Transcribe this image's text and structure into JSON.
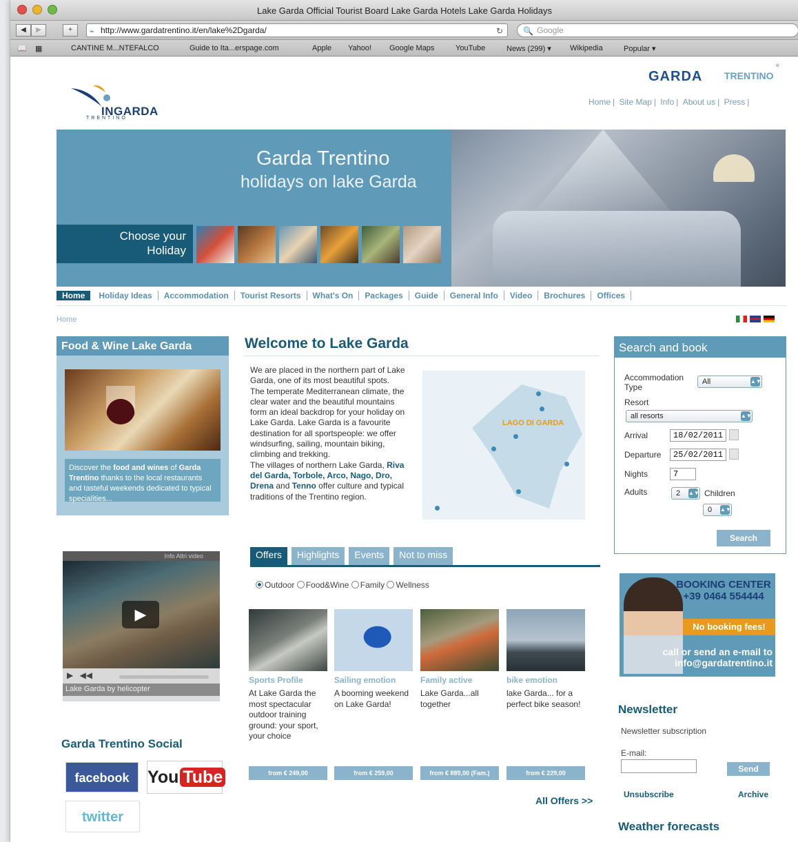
{
  "browser": {
    "title": "Lake Garda Official Tourist Board Lake Garda Hotels Lake Garda Holidays",
    "url": "http://www.gardatrentino.it/en/lake%2Dgarda/",
    "search_placeholder": "Google",
    "bookmarks": [
      "CANTINE M...NTEFALCO",
      "Guide to Ita...erspage.com",
      "Apple",
      "Yahoo!",
      "Google Maps",
      "YouTube",
      "News (299) ▾",
      "Wikipedia",
      "Popular ▾"
    ]
  },
  "header": {
    "logo_text": "INGARDA",
    "logo_sub": "TRENTINO",
    "brand_garda": "GARDA",
    "brand_trentino": "TRENTINO",
    "top_links": [
      "Home",
      "Site Map",
      "Info",
      "About us",
      "Press"
    ]
  },
  "hero": {
    "title": "Garda Trentino",
    "subtitle": "holidays on lake Garda",
    "choose_line1": "Choose your",
    "choose_line2": "Holiday"
  },
  "nav": {
    "items": [
      "Home",
      "Holiday Ideas",
      "Accommodation",
      "Tourist Resorts",
      "What's On",
      "Packages",
      "Guide",
      "General Info",
      "Video",
      "Brochures",
      "Offices"
    ]
  },
  "breadcrumb": "Home",
  "food_wine": {
    "title": "Food & Wine Lake Garda",
    "text_pre": "Discover the ",
    "text_bold": "food and wines",
    "text_mid": " of ",
    "text_bold2": "Garda Trentino",
    "text_post": " thanks to the local restaurants and tasteful weekends dedicated to typical specialities..."
  },
  "video": {
    "controls_label": "Info  Altri video",
    "caption": "Lake Garda by helicopter"
  },
  "social": {
    "title": "Garda Trentino Social",
    "facebook": "facebook",
    "youtube_you": "You",
    "youtube_tube": "Tube",
    "twitter": "twitter"
  },
  "welcome": {
    "title": "Welcome to Lake Garda",
    "p1": "We are placed in the northern part of Lake Garda, one of its most beautiful spots.",
    "p2": "The temperate Mediterranean climate, the clear water and the beautiful mountains form an ideal backdrop for your holiday on Lake Garda. Lake Garda is a favourite destination for all sportspeople: we offer windsurfing, sailing, mountain biking, climbing and trekking.",
    "p3_pre": "The villages of northern Lake Garda, ",
    "p3_towns": "Riva del Garda, Torbole, Arco, Nago, Dro, Drena",
    "p3_and": " and ",
    "p3_tenno": "Tenno",
    "p3_post": " offer culture and typical traditions of the Trentino region.",
    "map_label": "LAGO DI GARDA"
  },
  "offers": {
    "tabs": [
      "Offers",
      "Highlights",
      "Events",
      "Not to miss"
    ],
    "filters": [
      "Outdoor",
      "Food&Wine",
      "Family",
      "Wellness"
    ],
    "items": [
      {
        "title": "Sports Profile",
        "text": "At Lake Garda the most spectacular outdoor training ground: your sport, your choice",
        "price": "from € 249,00"
      },
      {
        "title": "Sailing emotion",
        "text": "A booming weekend on Lake Garda!",
        "price": "from € 259,00"
      },
      {
        "title": "Family active",
        "text": "Lake Garda...all together",
        "price": "from € 889,00 (Fam.)"
      },
      {
        "title": "bike emotion",
        "text": "lake Garda... for a perfect bike season!",
        "price": "from € 229,00"
      }
    ],
    "all_offers": "All Offers >>"
  },
  "search_book": {
    "title": "Search and book",
    "accommodation_label": "Accommodation Type",
    "accommodation_value": "All",
    "resort_label": "Resort",
    "resort_value": "all resorts",
    "arrival_label": "Arrival",
    "arrival_value": "18/02/2011",
    "departure_label": "Departure",
    "departure_value": "25/02/2011",
    "nights_label": "Nights",
    "nights_value": "7",
    "adults_label": "Adults",
    "adults_value": "2",
    "children_label": "Children",
    "children_value": "0",
    "search_button": "Search"
  },
  "booking_center": {
    "heading": "BOOKING CENTER",
    "phone": "+39 0464 554444",
    "no_fees": "No booking fees!",
    "call_line1": "call or send an e-mail to",
    "call_line2": "info@gardatrentino.it"
  },
  "newsletter": {
    "title": "Newsletter",
    "subtitle": "Newsletter subscription",
    "email_label": "E-mail:",
    "send": "Send",
    "unsubscribe": "Unsubscribe",
    "archive": "Archive"
  },
  "weather": {
    "title": "Weather forecasts"
  }
}
